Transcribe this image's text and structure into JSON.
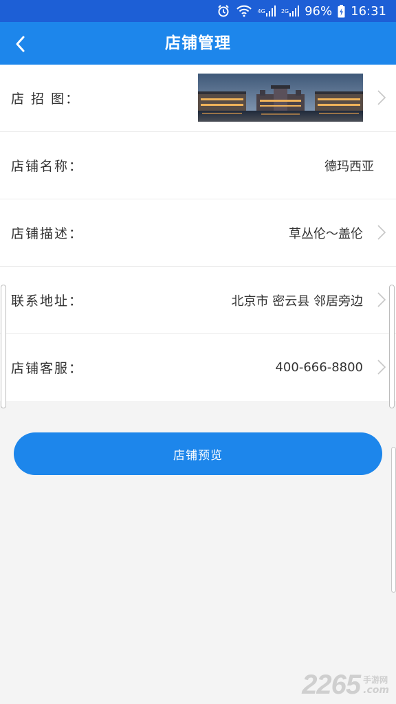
{
  "status_bar": {
    "battery": "96%",
    "time": "16:31",
    "signal_label_1": "4G",
    "signal_label_2": "2G"
  },
  "header": {
    "title": "店铺管理"
  },
  "rows": [
    {
      "label": "店 招 图：",
      "value": ""
    },
    {
      "label": "店铺名称：",
      "value": "德玛西亚"
    },
    {
      "label": "店铺描述：",
      "value": "草丛伦～盖伦"
    },
    {
      "label": "联系地址：",
      "value": "北京市 密云县 邻居旁边"
    },
    {
      "label": "店铺客服：",
      "value": "400-666-8800"
    }
  ],
  "preview_button": {
    "label": "店铺预览"
  },
  "watermark": {
    "number": "2265",
    "cn": "手游网",
    "domain": ".com"
  },
  "colors": {
    "status_bar": "#1d5fd6",
    "app_bar": "#1d86eb",
    "button": "#1d86eb",
    "background": "#f4f4f4"
  }
}
